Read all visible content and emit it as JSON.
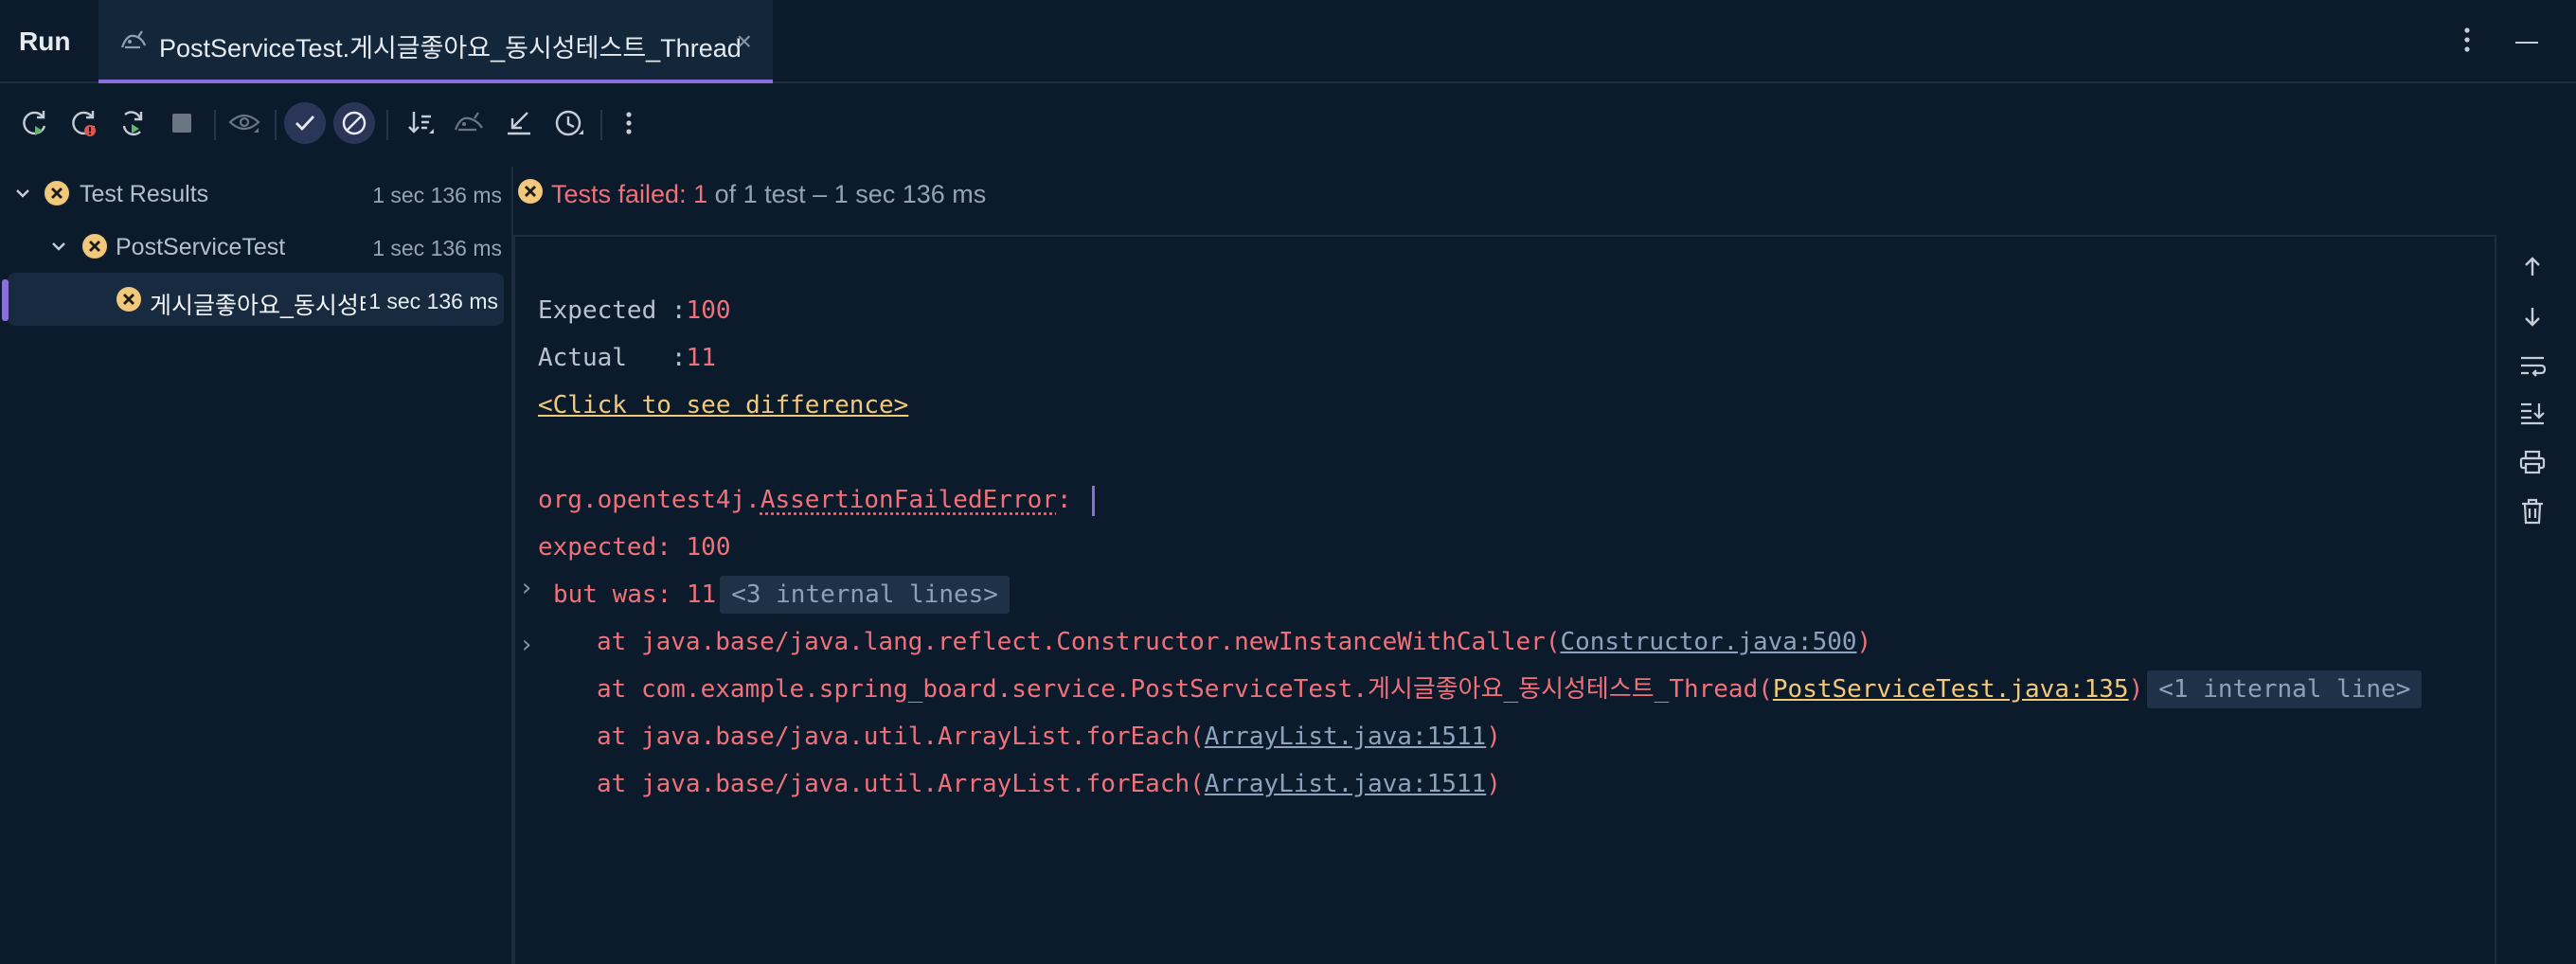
{
  "header": {
    "run_label": "Run",
    "tab_title": "PostServiceTest.게시글좋아요_동시성테스트_Thread",
    "tab_close": "×"
  },
  "toolbar": {
    "buttons": [
      "rerun-icon",
      "rerun-failed-icon",
      "toggle-auto-test-icon",
      "stop-icon",
      "show-ignored-icon",
      "show-passed-icon",
      "show-ignored-toggle-icon",
      "sort-icon",
      "import-tests-icon",
      "export-tests-icon",
      "history-icon",
      "more-icon"
    ]
  },
  "tree": {
    "root": {
      "label": "Test Results",
      "time": "1 sec 136 ms"
    },
    "class": {
      "label": "PostServiceTest",
      "time": "1 sec 136 ms"
    },
    "method": {
      "label": "게시글좋아요_동시성테스트_Thread",
      "time": "1 sec 136 ms"
    }
  },
  "status": {
    "prefix": "Tests failed: 1",
    "suffix": " of 1 test – 1 sec 136 ms"
  },
  "console": {
    "expected_label": "Expected :",
    "expected_value": "100",
    "actual_label": "Actual   :",
    "actual_value": "11",
    "diff_link": "<Click to see difference>",
    "error_pkg": "org.opentest4j.",
    "error_class": "AssertionFailedError",
    "error_colon": ": ",
    "expected_line": "expected: 100",
    "but_was": "but was: 11",
    "fold1": "<3 internal lines>",
    "st1_prefix": "at java.base/java.lang.reflect.Constructor.newInstanceWithCaller(",
    "st1_link": "Constructor.java:500",
    "st1_suffix": ")",
    "st2_prefix": "at com.example.spring_board.service.PostServiceTest.게시글좋아요_동시성테스트_Thread(",
    "st2_link": "PostServiceTest.java:135",
    "st2_suffix": ")",
    "fold2": "<1 internal line>",
    "st3_prefix": "at java.base/java.util.ArrayList.forEach(",
    "st3_link": "ArrayList.java:1511",
    "st3_suffix": ")",
    "st4_prefix": "at java.base/java.util.ArrayList.forEach(",
    "st4_link": "ArrayList.java:1511",
    "st4_suffix": ")"
  },
  "gutter": {
    "buttons": [
      "up-arrow-icon",
      "down-arrow-icon",
      "soft-wrap-icon",
      "scroll-to-end-icon",
      "print-icon",
      "clear-icon"
    ]
  },
  "colors": {
    "background": "#0c1b2b",
    "accent": "#8a6fd8",
    "error": "#f0717a",
    "warning_icon": "#f2c97a",
    "link": "#f2c97a"
  }
}
